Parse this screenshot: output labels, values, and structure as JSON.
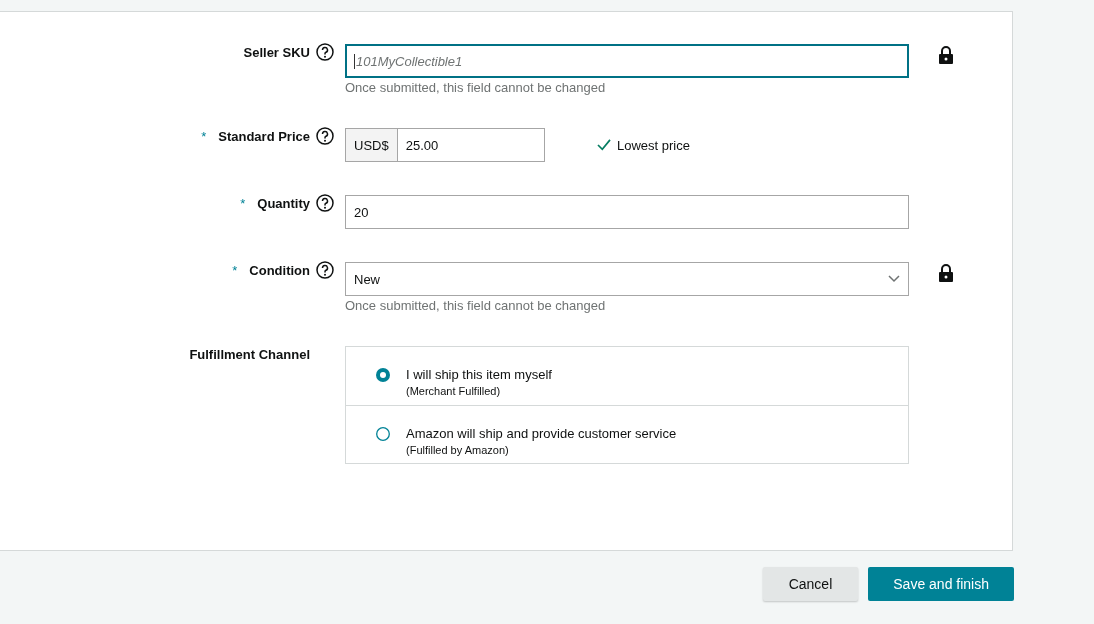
{
  "fields": [
    {
      "kind": "text",
      "label": "Seller SKU",
      "help": true,
      "placeholder": "101MyCollectible1",
      "focused": true,
      "locked": true,
      "note": "Once submitted, this field cannot be changed"
    },
    {
      "kind": "price",
      "label": "Standard Price",
      "required_mark": "*",
      "help": true,
      "prefix": "USD$",
      "value": "25.00",
      "locked": false,
      "status": "Lowest price"
    },
    {
      "kind": "text",
      "label": "Quantity",
      "required_mark": "*",
      "help": true,
      "value": "20",
      "focused": false,
      "locked": false
    },
    {
      "kind": "select",
      "label": "Condition",
      "required_mark": "*",
      "help": true,
      "value": "New",
      "locked": true,
      "note": "Once submitted, this field cannot be changed"
    },
    {
      "kind": "radio",
      "label": "Fulfillment Channel",
      "help": false,
      "options": [
        {
          "title": "I will ship this item myself",
          "subtitle": "(Merchant Fulfilled)",
          "selected": true
        },
        {
          "title": "Amazon will ship and provide customer service",
          "subtitle": "(Fulfilled by Amazon)",
          "selected": false
        }
      ]
    }
  ],
  "buttons": [
    {
      "label": "Cancel",
      "kind": "secondary"
    },
    {
      "label": "Save and finish",
      "kind": "primary"
    }
  ]
}
